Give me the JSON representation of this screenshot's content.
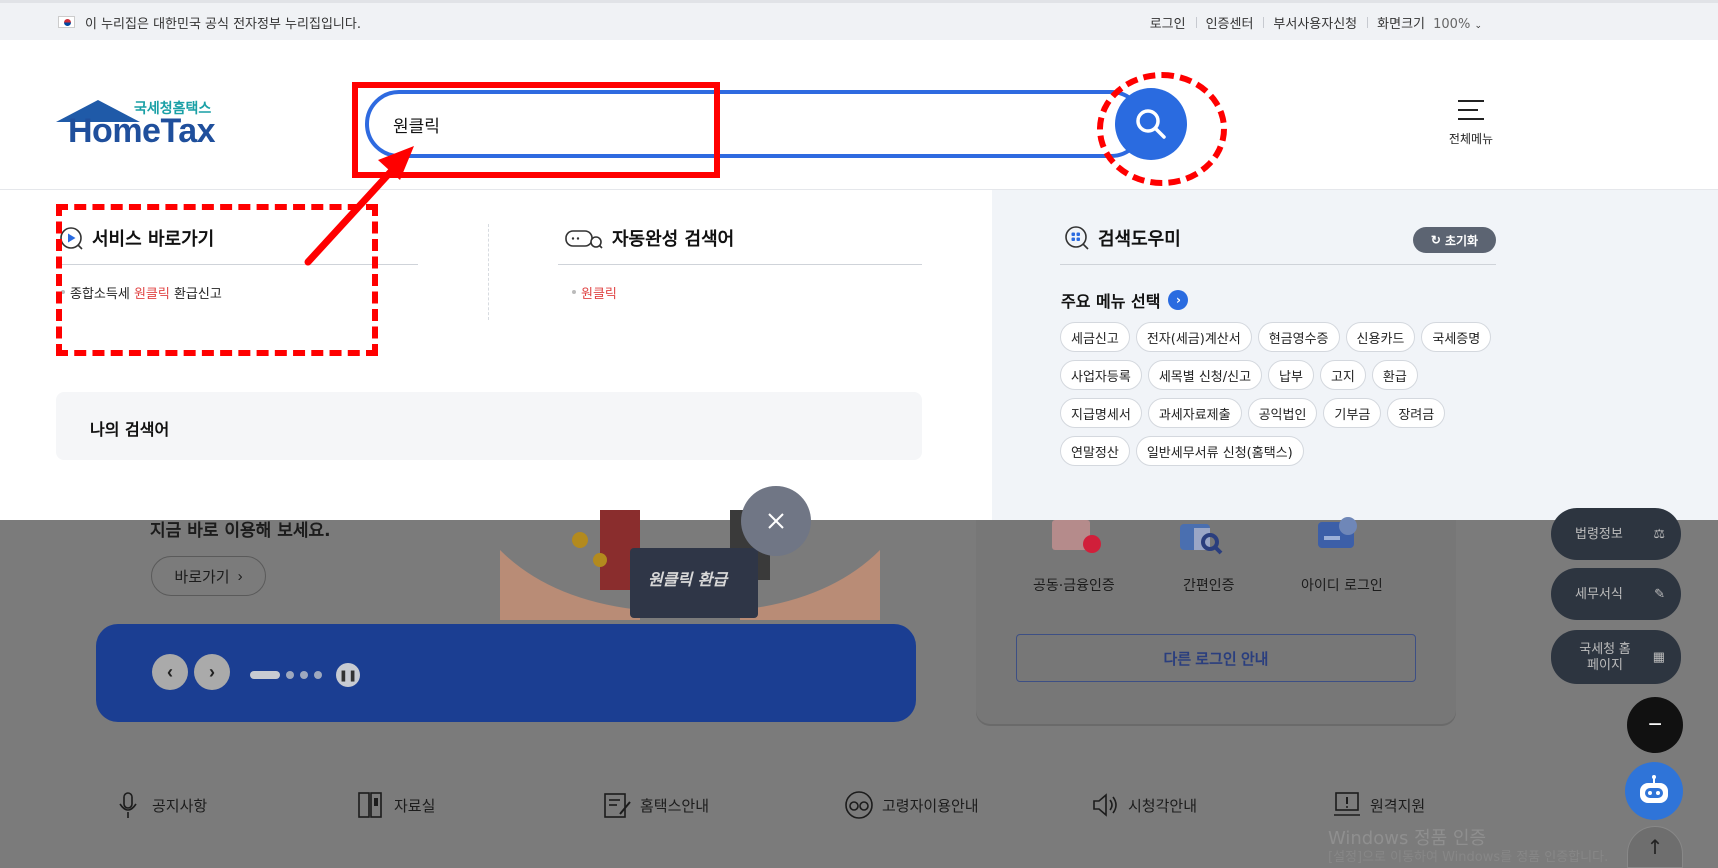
{
  "gov_banner": {
    "text": "이 누리집은 대한민국 공식 전자정부 누리집입니다."
  },
  "util_links": {
    "login": "로그인",
    "cert": "인증센터",
    "dept": "부서사용자신청",
    "zoom_label": "화면크기",
    "zoom_value": "100%"
  },
  "logo": {
    "sub": "국세청홈택스",
    "main": "HomeTax"
  },
  "search": {
    "value": "원클릭",
    "placeholder": ""
  },
  "all_menu": {
    "label": "전체메뉴"
  },
  "service_shortcut": {
    "title": "서비스 바로가기",
    "items": [
      {
        "prefix": "종합소득세 ",
        "highlight": "원클릭",
        "suffix": " 환급신고"
      }
    ]
  },
  "autocomplete": {
    "title": "자동완성 검색어",
    "items": [
      "원클릭"
    ]
  },
  "my_search": {
    "title": "나의 검색어"
  },
  "search_helper": {
    "title": "검색도우미",
    "reset": "초기화",
    "menu_select": "주요 메뉴 선택",
    "chips": [
      "세금신고",
      "전자(세금)계산서",
      "현금영수증",
      "신용카드",
      "국세증명",
      "사업자등록",
      "세목별 신청/신고",
      "납부",
      "고지",
      "환급",
      "지급명세서",
      "과세자료제출",
      "공익법인",
      "기부금",
      "장려금",
      "연말정산",
      "일반세무서류 신청(홈택스)"
    ]
  },
  "background": {
    "subtitle": "지금 바로 이용해 보세요.",
    "go_button": "바로가기",
    "card_text": "원클릭 환급",
    "login_options": [
      "공동·금융인증",
      "간편인증",
      "아이디 로그인"
    ],
    "other_login": "다른 로그인 안내",
    "side_buttons": [
      "법령정보",
      "세무서식",
      "국세청 홈페이지"
    ],
    "nav": [
      "공지사항",
      "자료실",
      "홈택스안내",
      "고령자이용안내",
      "시청각안내",
      "원격지원"
    ],
    "windows_watermark": {
      "line1": "Windows 정품 인증",
      "line2": "[설정]으로 이동하여 Windows를 정품 인증합니다."
    }
  }
}
